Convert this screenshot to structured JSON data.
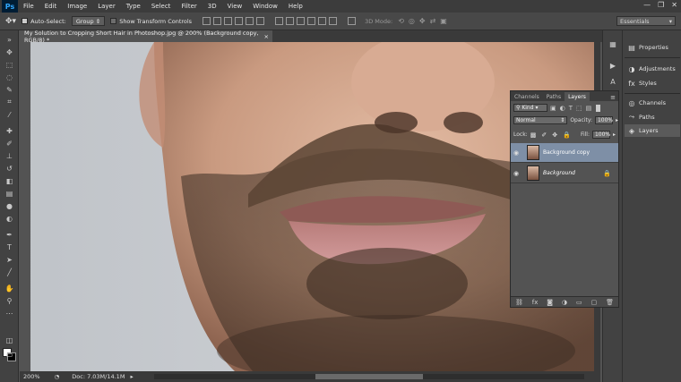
{
  "app": {
    "logo": "Ps"
  },
  "menu": [
    "File",
    "Edit",
    "Image",
    "Layer",
    "Type",
    "Select",
    "Filter",
    "3D",
    "View",
    "Window",
    "Help"
  ],
  "window_controls": [
    "—",
    "❐",
    "✕"
  ],
  "options": {
    "auto_select_label": "Auto-Select:",
    "auto_select_value": "Group",
    "transform_label": "Show Transform Controls",
    "mode_label": "3D Mode:",
    "workspace": "Essentials"
  },
  "document": {
    "tab_title": "My Solution to Cropping Short Hair in Photoshop.jpg @ 200% (Background copy, RGB/8) *",
    "tab_close": "×",
    "zoom": "200%",
    "doc_size": "Doc: 7.03M/14.1M"
  },
  "right_panels": [
    {
      "label": "Properties",
      "icon": "properties-icon"
    },
    {
      "label": "Adjustments",
      "icon": "adjustments-icon"
    },
    {
      "label": "Styles",
      "icon": "styles-icon"
    },
    {
      "label": "Channels",
      "icon": "channels-icon"
    },
    {
      "label": "Paths",
      "icon": "paths-icon"
    },
    {
      "label": "Layers",
      "icon": "layers-icon"
    }
  ],
  "layers_panel": {
    "tabs": [
      "Channels",
      "Paths",
      "Layers"
    ],
    "active_tab": "Layers",
    "filter_kind": "Kind",
    "blend_mode": "Normal",
    "opacity_label": "Opacity:",
    "opacity_value": "100%",
    "lock_label": "Lock:",
    "fill_label": "Fill:",
    "fill_value": "100%",
    "layers": [
      {
        "name": "Background copy",
        "selected": true,
        "locked": false
      },
      {
        "name": "Background",
        "selected": false,
        "locked": true
      }
    ]
  }
}
